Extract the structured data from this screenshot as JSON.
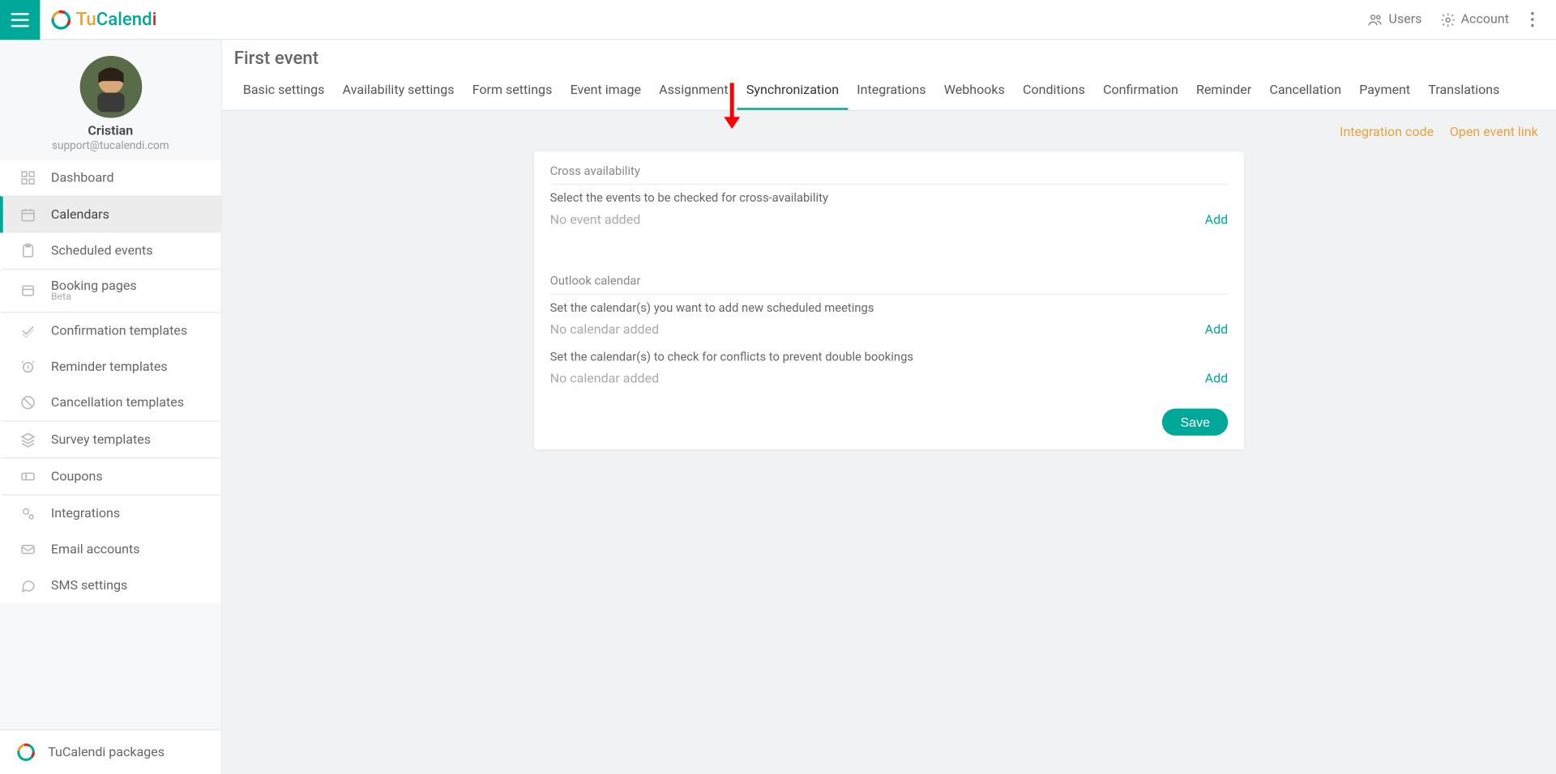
{
  "brand": {
    "t1": "Tu",
    "t2": "Calend",
    "t3": "i"
  },
  "header_actions": {
    "users": "Users",
    "account": "Account"
  },
  "profile": {
    "name": "Cristian",
    "email": "support@tucalendi.com"
  },
  "sidebar": {
    "items": [
      {
        "label": "Dashboard"
      },
      {
        "label": "Calendars"
      },
      {
        "label": "Scheduled events"
      },
      {
        "label": "Booking pages",
        "badge": "Beta"
      },
      {
        "label": "Confirmation templates"
      },
      {
        "label": "Reminder templates"
      },
      {
        "label": "Cancellation templates"
      },
      {
        "label": "Survey templates"
      },
      {
        "label": "Coupons"
      },
      {
        "label": "Integrations"
      },
      {
        "label": "Email accounts"
      },
      {
        "label": "SMS settings"
      }
    ],
    "footer": "TuCalendi packages"
  },
  "page": {
    "title": "First event",
    "tabs": [
      "Basic settings",
      "Availability settings",
      "Form settings",
      "Event image",
      "Assignment",
      "Synchronization",
      "Integrations",
      "Webhooks",
      "Conditions",
      "Confirmation",
      "Reminder",
      "Cancellation",
      "Payment",
      "Translations"
    ],
    "active_tab": "Synchronization",
    "links": {
      "integration_code": "Integration code",
      "open_event_link": "Open event link"
    }
  },
  "card": {
    "cross": {
      "title": "Cross availability",
      "desc": "Select the events to be checked for cross-availability",
      "placeholder": "No event added",
      "add": "Add"
    },
    "outlook": {
      "title": "Outlook calendar",
      "desc1": "Set the calendar(s) you want to add new scheduled meetings",
      "placeholder1": "No calendar added",
      "add1": "Add",
      "desc2": "Set the calendar(s) to check for conflicts to prevent double bookings",
      "placeholder2": "No calendar added",
      "add2": "Add"
    },
    "save": "Save"
  }
}
